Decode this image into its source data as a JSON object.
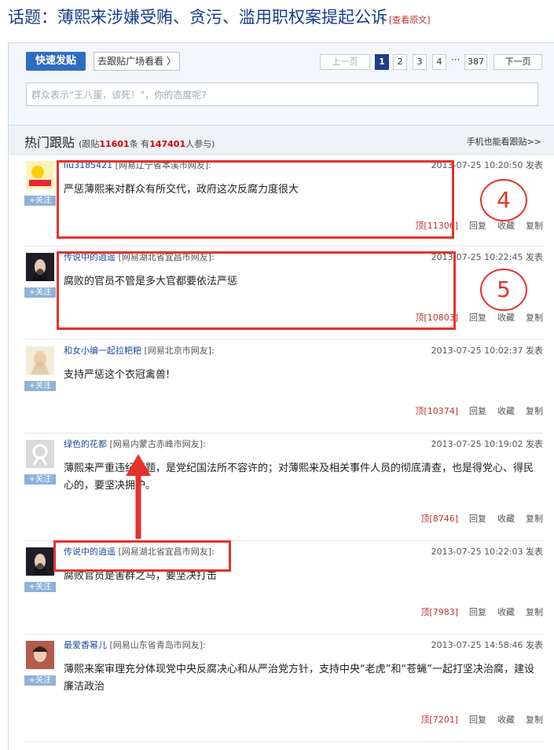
{
  "topic": {
    "title": "话题：薄熙来涉嫌受贿、贪污、滥用职权案提起公诉",
    "view_original": "[查看原文]"
  },
  "post_area": {
    "post_button": "快速发贴",
    "plaza_button": "去跟贴广场看看",
    "input_placeholder": "群众表示“王八蛋，该死！”，你的态度呢?"
  },
  "pagination": {
    "prev": "上一页",
    "pages": [
      "1",
      "2",
      "3",
      "4"
    ],
    "current": "1",
    "dots": "···",
    "last": "387",
    "next": "下一页"
  },
  "hot": {
    "title": "热门跟贴",
    "stats_prefix": "(跟贴",
    "count": "11601",
    "stats_mid": "条 有",
    "participants": "147401",
    "stats_suffix": "人参与)",
    "mobile_link": "手机也能看跟贴>>"
  },
  "follow_label": "+关注",
  "posts": [
    {
      "user": "liu3185421",
      "location": "[网易辽宁省本溪市网友]:",
      "time": "2013-07-25 10:20:50 发表",
      "content": "严惩薄熙来对群众有所交代，政府这次反腐力度很大",
      "top": "顶[11306]",
      "reply": "回复",
      "collect": "收藏",
      "copy": "复制"
    },
    {
      "user": "传说中的逍遥",
      "location": "[网易湖北省宜昌市网友]:",
      "time": "2013-07-25 10:22:45 发表",
      "content": "腐败的官员不管是多大官都要依法严惩",
      "top": "顶[10803]",
      "reply": "回复",
      "collect": "收藏",
      "copy": "复制"
    },
    {
      "user": "和女小编一起拉粑粑",
      "location": "[网易北京市网友]:",
      "time": "2013-07-25 10:02:37 发表",
      "content": "支持严惩这个衣冠禽兽!",
      "top": "顶[10374]",
      "reply": "回复",
      "collect": "收藏",
      "copy": "复制"
    },
    {
      "user": "绿色的花都",
      "location": "[网易内蒙古赤峰市网友]:",
      "time": "2013-07-25 10:19:02 发表",
      "content": "薄熙来严重违纪问题，是党纪国法所不容许的；对薄熙来及相关事件人员的彻底清查，也是得党心、得民心的，要坚决拥护。",
      "top": "顶[8746]",
      "reply": "回复",
      "collect": "收藏",
      "copy": "复制"
    },
    {
      "user": "传说中的逍遥",
      "location": "[网易湖北省宜昌市网友]:",
      "time": "2013-07-25 10:22:03 发表",
      "content": "腐败官员是害群之马，要坚决打击",
      "top": "顶[7983]",
      "reply": "回复",
      "collect": "收藏",
      "copy": "复制"
    },
    {
      "user": "最爱香幂儿",
      "location": "[网易山东省青岛市网友]:",
      "time": "2013-07-25 14:58:46 发表",
      "content": "薄熙来案审理充分体现党中央反腐决心和从严治党方针，支持中央“老虎”和“苍蝇”一起打坚决治腐，建设廉洁政治",
      "top": "顶[7201]",
      "reply": "回复",
      "collect": "收藏",
      "copy": "复制"
    }
  ],
  "annotations": {
    "circle_a": "4",
    "circle_b": "5"
  },
  "colors": {
    "highlight": "#e5322d",
    "link_blue": "#1f4a9c",
    "post_button": "#2d6cc1"
  }
}
